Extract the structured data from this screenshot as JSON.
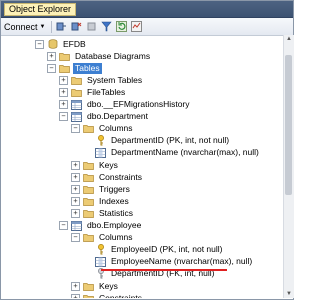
{
  "window": {
    "title": "Object Explorer"
  },
  "toolbar": {
    "connect_label": "Connect"
  },
  "tree": [
    {
      "label": "EFDB",
      "expander": "-",
      "icon": "database-icon"
    },
    {
      "label": "Database Diagrams",
      "expander": "+",
      "icon": "folder-icon"
    },
    {
      "label": "Tables",
      "expander": "-",
      "icon": "folder-icon",
      "selected": true
    },
    {
      "label": "System Tables",
      "expander": "+",
      "icon": "folder-icon"
    },
    {
      "label": "FileTables",
      "expander": "+",
      "icon": "folder-icon"
    },
    {
      "label": "dbo.__EFMigrationsHistory",
      "expander": "+",
      "icon": "table-icon"
    },
    {
      "label": "dbo.Department",
      "expander": "-",
      "icon": "table-icon"
    },
    {
      "label": "Columns",
      "expander": "-",
      "icon": "folder-icon"
    },
    {
      "label": "DepartmentID (PK, int, not null)",
      "expander": "",
      "icon": "key-icon"
    },
    {
      "label": "DepartmentName (nvarchar(max), null)",
      "expander": "",
      "icon": "column-icon"
    },
    {
      "label": "Keys",
      "expander": "+",
      "icon": "folder-icon"
    },
    {
      "label": "Constraints",
      "expander": "+",
      "icon": "folder-icon"
    },
    {
      "label": "Triggers",
      "expander": "+",
      "icon": "folder-icon"
    },
    {
      "label": "Indexes",
      "expander": "+",
      "icon": "folder-icon"
    },
    {
      "label": "Statistics",
      "expander": "+",
      "icon": "folder-icon"
    },
    {
      "label": "dbo.Employee",
      "expander": "-",
      "icon": "table-icon"
    },
    {
      "label": "Columns",
      "expander": "-",
      "icon": "folder-icon"
    },
    {
      "label": "EmployeeID (PK, int, not null)",
      "expander": "",
      "icon": "key-icon"
    },
    {
      "label": "EmployeeName (nvarchar(max), null)",
      "expander": "",
      "icon": "column-icon"
    },
    {
      "label": "DepartmentID (FK, int, null)",
      "expander": "",
      "icon": "foreign-key-icon"
    },
    {
      "label": "Keys",
      "expander": "+",
      "icon": "folder-icon"
    },
    {
      "label": "Constraints",
      "expander": "+",
      "icon": "folder-icon"
    }
  ],
  "colors": {
    "selection": "#3d7fd1",
    "highlight_underline": "#e02020",
    "folder": "#e9c46a",
    "key": "#e0b020"
  }
}
